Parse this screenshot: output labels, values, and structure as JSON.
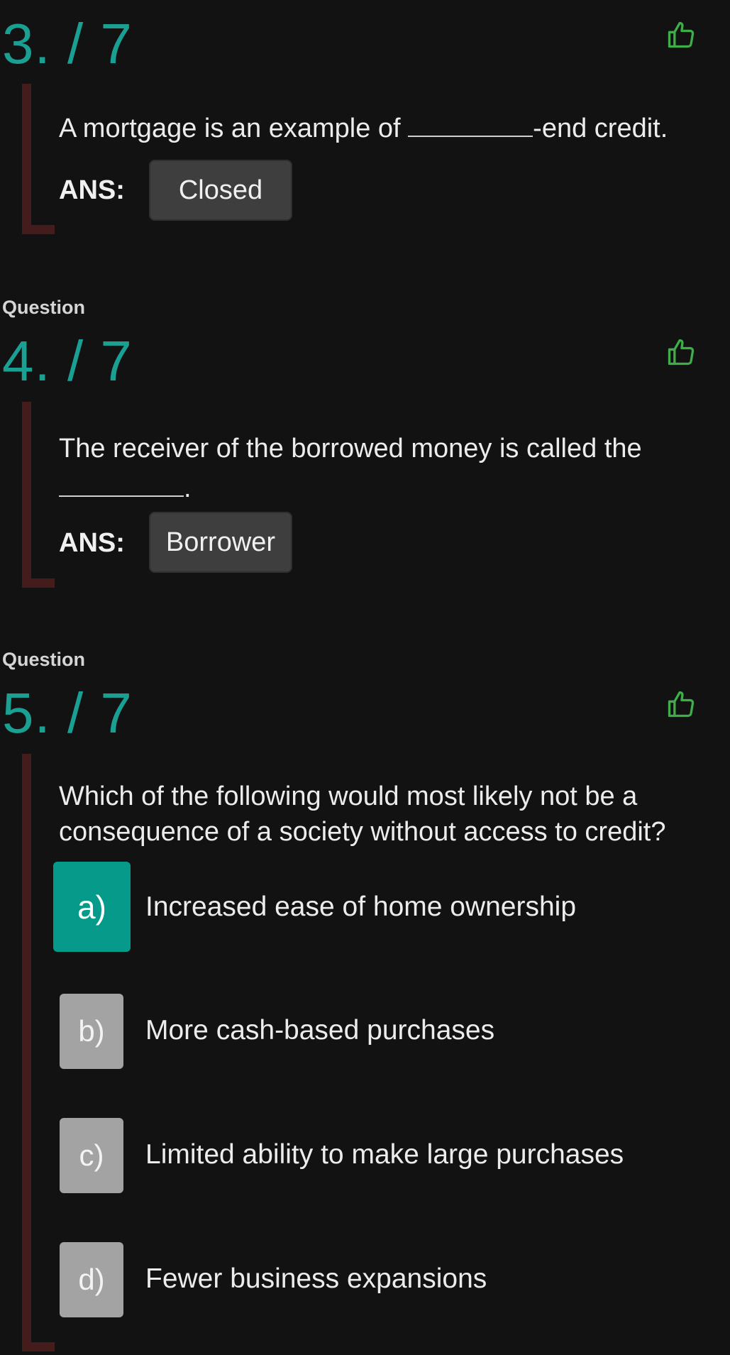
{
  "question_word": "Question",
  "questions": [
    {
      "number": "3. / 7",
      "text_before": "A mortgage is an example of ",
      "text_after": "-end credit.",
      "answer_label": "ANS:",
      "answer_value": "Closed"
    },
    {
      "number": "4. / 7",
      "text_before": "The receiver of the borrowed money is called the",
      "text_after": ".",
      "answer_label": "ANS:",
      "answer_value": "Borrower"
    },
    {
      "number": "5. / 7",
      "text": "Which of the following would most likely not be a consequence of a society without access to credit?",
      "options": [
        {
          "letter": "a)",
          "text": "Increased ease of home ownership",
          "selected": true
        },
        {
          "letter": "b)",
          "text": "More cash-based purchases",
          "selected": false
        },
        {
          "letter": "c)",
          "text": "Limited ability to make large purchases",
          "selected": false
        },
        {
          "letter": "d)",
          "text": "Fewer business expansions",
          "selected": false
        }
      ]
    }
  ],
  "icons": {
    "like": "thumbs-up-icon"
  },
  "colors": {
    "background": "#121212",
    "accent": "#1aa093",
    "selected_option": "#069a8a",
    "option_letter": "#a3a3a3",
    "bar": "#451c1c",
    "like_icon": "#3fae49",
    "answer_box": "#3e3e3e"
  }
}
